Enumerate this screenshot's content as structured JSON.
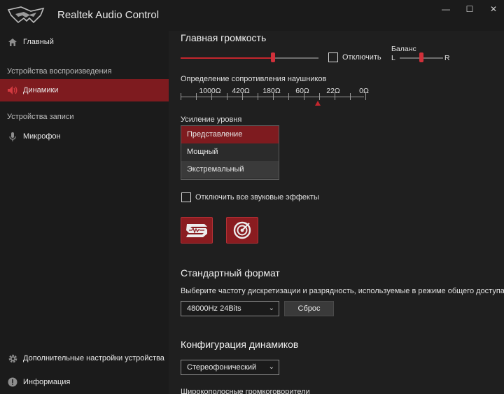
{
  "window": {
    "title": "Realtek Audio Control",
    "controls": {
      "minimize": "—",
      "maximize": "☐",
      "close": "✕"
    }
  },
  "sidebar": {
    "home": {
      "label": "Главный",
      "icon": "home-icon"
    },
    "playback_header": "Устройства воспроизведения",
    "speakers": {
      "label": "Динамики",
      "icon": "speaker-icon"
    },
    "recording_header": "Устройства записи",
    "microphone": {
      "label": "Микрофон",
      "icon": "microphone-icon"
    },
    "advanced": {
      "label": "Дополнительные настройки устройства",
      "icon": "gear-icon"
    },
    "info": {
      "label": "Информация",
      "icon": "info-icon"
    }
  },
  "volume": {
    "title": "Главная громкость",
    "level": 0.67,
    "mute_label": "Отключить",
    "balance_label": "Баланс",
    "balance_left": "L",
    "balance_right": "R",
    "balance_value": 0.5
  },
  "impedance": {
    "title": "Определение сопротивления наушников",
    "marks": [
      "1000Ω",
      "420Ω",
      "180Ω",
      "60Ω",
      "22Ω",
      "0Ω"
    ],
    "selected_index": 3.5
  },
  "gain": {
    "title": "Усиление уровня",
    "options": [
      "Представление",
      "Мощный",
      "Экстремальный"
    ],
    "selected": 0,
    "hovered": 2
  },
  "effects": {
    "disable_all_label": "Отключить все звуковые эффекты"
  },
  "format": {
    "title": "Стандартный формат",
    "description": "Выберите частоту дискретизации и разрядность, используемые в режиме общего доступа.",
    "value": "48000Hz 24Bits",
    "reset_label": "Сброс"
  },
  "speaker_config": {
    "title": "Конфигурация динамиков",
    "value": "Стереофонический",
    "next_section_cut": "Широкополосные громкоговорители"
  },
  "colors": {
    "accent": "#c4262d",
    "selected_bg": "#7e1b1f",
    "background": "#1b1b1b"
  }
}
